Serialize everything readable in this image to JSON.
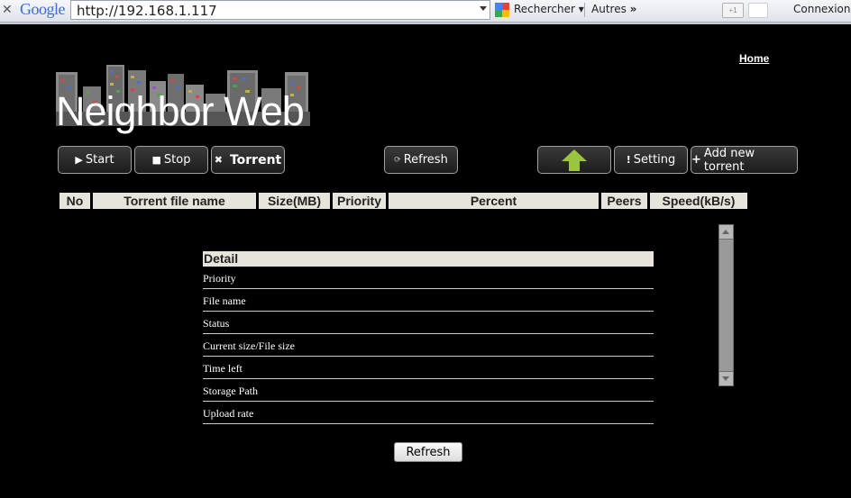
{
  "browser": {
    "url": "http://192.168.1.117",
    "brand": "Google",
    "search_label": "Rechercher",
    "search_arrow": "▾",
    "other_label": "Autres",
    "other_arrow": "»",
    "plusone_label": "+1",
    "connect_label": "Connexion"
  },
  "header": {
    "home_link": "Home",
    "logo_text": "Neighbor Web"
  },
  "toolbar": {
    "start_label": "Start",
    "stop_label": "Stop",
    "torrent_label": "Torrent",
    "refresh_label": "Refresh",
    "setting_label": "Setting",
    "add_label": "Add new torrent",
    "colors": {
      "upload_arrow": "#9bc43f"
    }
  },
  "table": {
    "columns": [
      "No",
      "Torrent file name",
      "Size(MB)",
      "Priority",
      "Percent",
      "Peers",
      "Speed(kB/s)"
    ]
  },
  "detail": {
    "title": "Detail",
    "fields": [
      "Priority",
      "File name",
      "Status",
      "Current size/File size",
      "Time left",
      "Storage Path",
      "Upload rate"
    ]
  },
  "footer": {
    "refresh_label": "Refresh"
  }
}
